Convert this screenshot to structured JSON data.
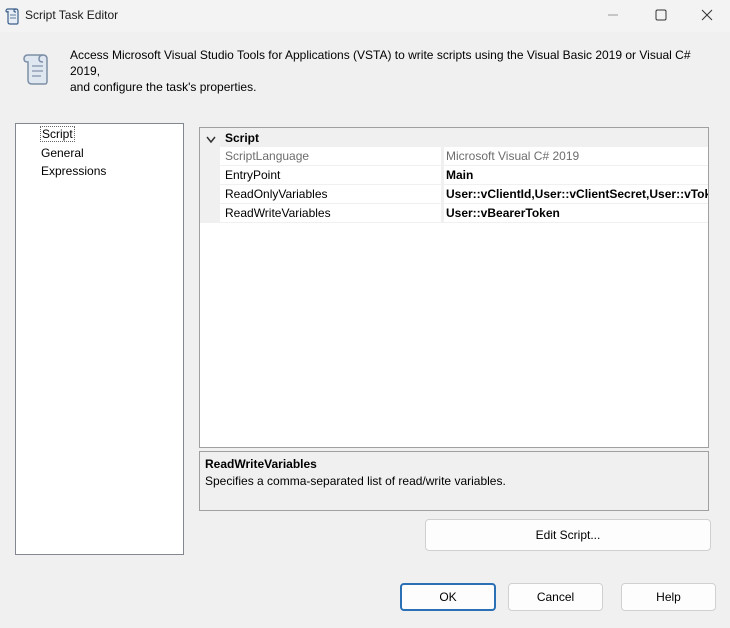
{
  "window": {
    "title": "Script Task Editor",
    "icon": "script-scroll-icon",
    "controls": [
      "minimize-icon",
      "maximize-icon",
      "close-icon"
    ]
  },
  "header": {
    "icon": "script-scroll-icon",
    "line1": "Access Microsoft Visual Studio Tools for Applications (VSTA) to write scripts using the Visual Basic 2019 or Visual C# 2019,",
    "line2": "and configure the task's properties."
  },
  "nav": {
    "items": [
      {
        "label": "Script",
        "selected": true
      },
      {
        "label": "General",
        "selected": false
      },
      {
        "label": "Expressions",
        "selected": false
      }
    ]
  },
  "property_grid": {
    "category": "Script",
    "category_toggle_icon": "chevron-down-icon",
    "rows": [
      {
        "name": "ScriptLanguage",
        "value": "Microsoft Visual C# 2019",
        "readonly": true
      },
      {
        "name": "EntryPoint",
        "value": "Main",
        "readonly": false
      },
      {
        "name": "ReadOnlyVariables",
        "value": "User::vClientId,User::vClientSecret,User::vToke",
        "readonly": false
      },
      {
        "name": "ReadWriteVariables",
        "value": "User::vBearerToken",
        "readonly": false
      }
    ]
  },
  "description": {
    "title": "ReadWriteVariables",
    "text": "Specifies a comma-separated list of read/write variables."
  },
  "buttons": {
    "edit_script": "Edit Script...",
    "ok": "OK",
    "cancel": "Cancel",
    "help": "Help"
  },
  "colors": {
    "accent": "#2b6fb5",
    "background": "#f0f0f0",
    "readonly_text": "#6d6d6d"
  }
}
